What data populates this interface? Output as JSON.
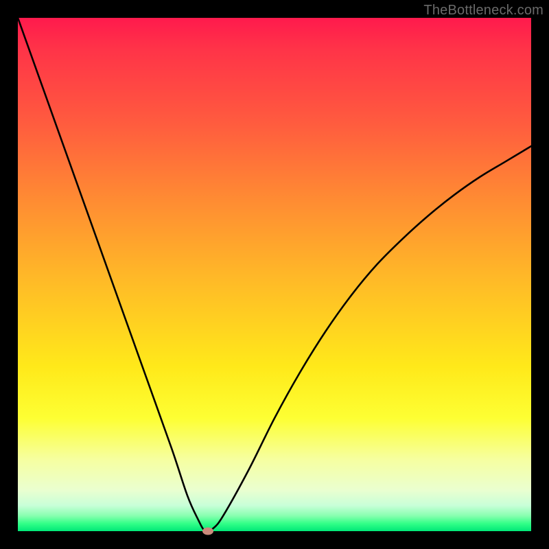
{
  "watermark": "TheBottleneck.com",
  "chart_data": {
    "type": "line",
    "title": "",
    "xlabel": "",
    "ylabel": "",
    "xlim": [
      0,
      100
    ],
    "ylim": [
      0,
      100
    ],
    "grid": false,
    "legend": false,
    "series": [
      {
        "name": "bottleneck-curve",
        "x": [
          0,
          5,
          10,
          15,
          20,
          25,
          30,
          33,
          35,
          36.5,
          38,
          40,
          45,
          50,
          55,
          60,
          65,
          70,
          75,
          80,
          85,
          90,
          95,
          100
        ],
        "y": [
          100,
          86,
          72,
          58,
          44,
          30,
          16,
          7,
          2.5,
          0,
          0.5,
          3,
          12,
          22,
          31,
          39,
          46,
          52,
          57,
          61.5,
          65.5,
          69,
          72,
          75
        ]
      }
    ],
    "marker": {
      "x": 37,
      "y": 0,
      "color": "#cc8a7c"
    },
    "background_gradient": {
      "top": "#ff1a4d",
      "mid": "#ffe91a",
      "bottom": "#00e878"
    }
  }
}
